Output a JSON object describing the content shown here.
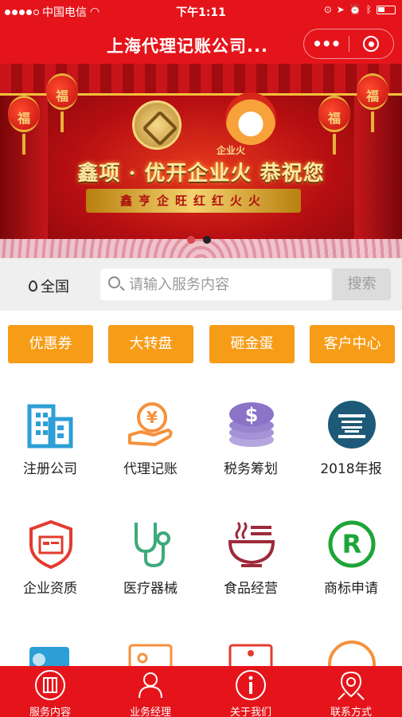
{
  "status_bar": {
    "carrier": "中国电信",
    "time": "下午1:11"
  },
  "nav": {
    "title": "上海代理记账公司...",
    "more_label": "•••"
  },
  "banner": {
    "lantern_text": "福",
    "brand_small": "企业火",
    "headline": "鑫项 · 优开企业火 恭祝您",
    "ribbon": "鑫亨企旺红红火火",
    "active_slide": 2,
    "slides": 2
  },
  "search": {
    "region": "全国",
    "placeholder": "请输入服务内容",
    "button": "搜索"
  },
  "quick_buttons": [
    "优惠券",
    "大转盘",
    "砸金蛋",
    "客户中心"
  ],
  "services": [
    {
      "label": "注册公司",
      "icon": "building-icon"
    },
    {
      "label": "代理记账",
      "icon": "yen-hand-icon"
    },
    {
      "label": "税务筹划",
      "icon": "coin-stack-icon"
    },
    {
      "label": "2018年报",
      "icon": "annual-report-icon"
    },
    {
      "label": "企业资质",
      "icon": "shield-card-icon"
    },
    {
      "label": "医疗器械",
      "icon": "stethoscope-icon"
    },
    {
      "label": "食品经营",
      "icon": "food-bowl-icon"
    },
    {
      "label": "商标申请",
      "icon": "registered-mark-icon"
    }
  ],
  "tabbar": [
    {
      "label": "服务内容",
      "icon": "service-icon"
    },
    {
      "label": "业务经理",
      "icon": "manager-icon"
    },
    {
      "label": "关于我们",
      "icon": "info-icon"
    },
    {
      "label": "联系方式",
      "icon": "location-icon"
    }
  ],
  "colors": {
    "brand_red": "#e5141b",
    "quick_orange": "#f79c16",
    "icon_blue": "#2c9fd6",
    "icon_orange": "#f5913d",
    "icon_purple": "#8b73c8",
    "icon_navy": "#1d5a77",
    "icon_red": "#e33b2e",
    "icon_green": "#3daa7c",
    "icon_maroon": "#9d2a3b",
    "icon_bright_green": "#1ea539"
  }
}
